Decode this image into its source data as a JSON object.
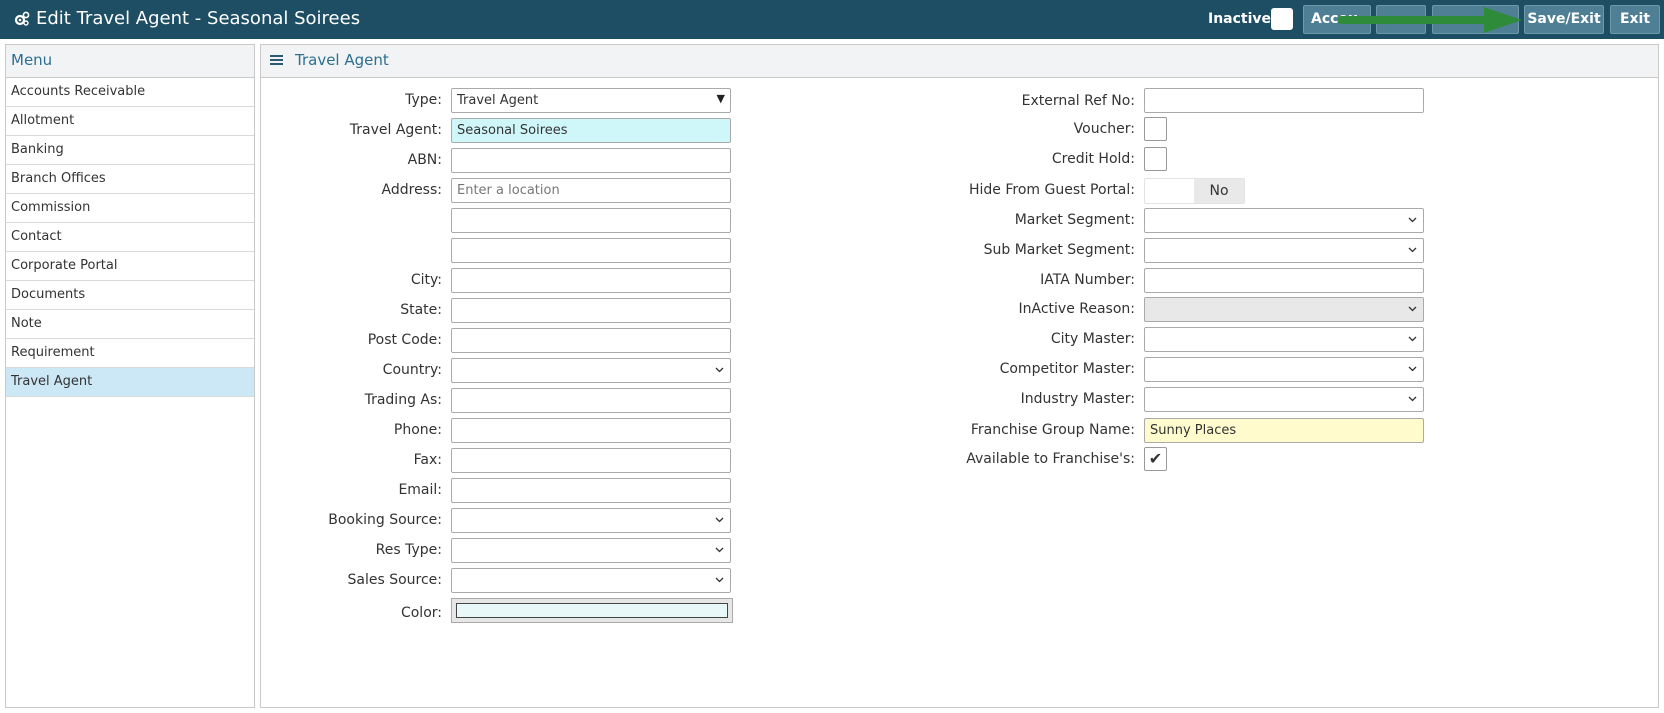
{
  "header": {
    "title": "Edit Travel Agent - Seasonal Soirees",
    "inactive_label": "Inactive",
    "buttons": {
      "accounts": "Accou",
      "btn2": "",
      "btn3": "",
      "save_exit": "Save/Exit",
      "exit": "Exit"
    },
    "arrow_color": "#2e8b3a"
  },
  "menu": {
    "title": "Menu",
    "items": [
      {
        "label": "Accounts Receivable"
      },
      {
        "label": "Allotment"
      },
      {
        "label": "Banking"
      },
      {
        "label": "Branch Offices"
      },
      {
        "label": "Commission"
      },
      {
        "label": "Contact"
      },
      {
        "label": "Corporate Portal"
      },
      {
        "label": "Documents"
      },
      {
        "label": "Note"
      },
      {
        "label": "Requirement"
      },
      {
        "label": "Travel Agent"
      }
    ],
    "active_index": 10
  },
  "panel": {
    "title": "Travel Agent"
  },
  "left_form": {
    "type": {
      "label": "Type:",
      "value": "Travel Agent"
    },
    "travel_agent": {
      "label": "Travel Agent:",
      "value": "Seasonal Soirees"
    },
    "abn": {
      "label": "ABN:",
      "value": ""
    },
    "address": {
      "label": "Address:",
      "placeholder": "Enter a location",
      "line2": "",
      "line3": ""
    },
    "city": {
      "label": "City:",
      "value": ""
    },
    "state": {
      "label": "State:",
      "value": ""
    },
    "post_code": {
      "label": "Post Code:",
      "value": ""
    },
    "country": {
      "label": "Country:",
      "value": ""
    },
    "trading_as": {
      "label": "Trading As:",
      "value": ""
    },
    "phone": {
      "label": "Phone:",
      "value": ""
    },
    "fax": {
      "label": "Fax:",
      "value": ""
    },
    "email": {
      "label": "Email:",
      "value": ""
    },
    "booking_source": {
      "label": "Booking Source:",
      "value": ""
    },
    "res_type": {
      "label": "Res Type:",
      "value": ""
    },
    "sales_source": {
      "label": "Sales Source:",
      "value": ""
    },
    "color": {
      "label": "Color:",
      "value": "#e8f7f8"
    }
  },
  "right_form": {
    "external_ref": {
      "label": "External Ref No:",
      "value": ""
    },
    "voucher": {
      "label": "Voucher:",
      "checked": false
    },
    "credit_hold": {
      "label": "Credit Hold:",
      "checked": false
    },
    "hide_portal": {
      "label": "Hide From Guest Portal:",
      "value": "No"
    },
    "market_segment": {
      "label": "Market Segment:",
      "value": ""
    },
    "sub_market_segment": {
      "label": "Sub Market Segment:",
      "value": ""
    },
    "iata": {
      "label": "IATA Number:",
      "value": ""
    },
    "inactive_reason": {
      "label": "InActive Reason:",
      "value": ""
    },
    "city_master": {
      "label": "City Master:",
      "value": ""
    },
    "competitor_master": {
      "label": "Competitor Master:",
      "value": ""
    },
    "industry_master": {
      "label": "Industry Master:",
      "value": ""
    },
    "franchise_group": {
      "label": "Franchise Group Name:",
      "value": "Sunny Places"
    },
    "available_franchise": {
      "label": "Available to Franchise's:",
      "checked": true,
      "mark": "✔"
    }
  }
}
